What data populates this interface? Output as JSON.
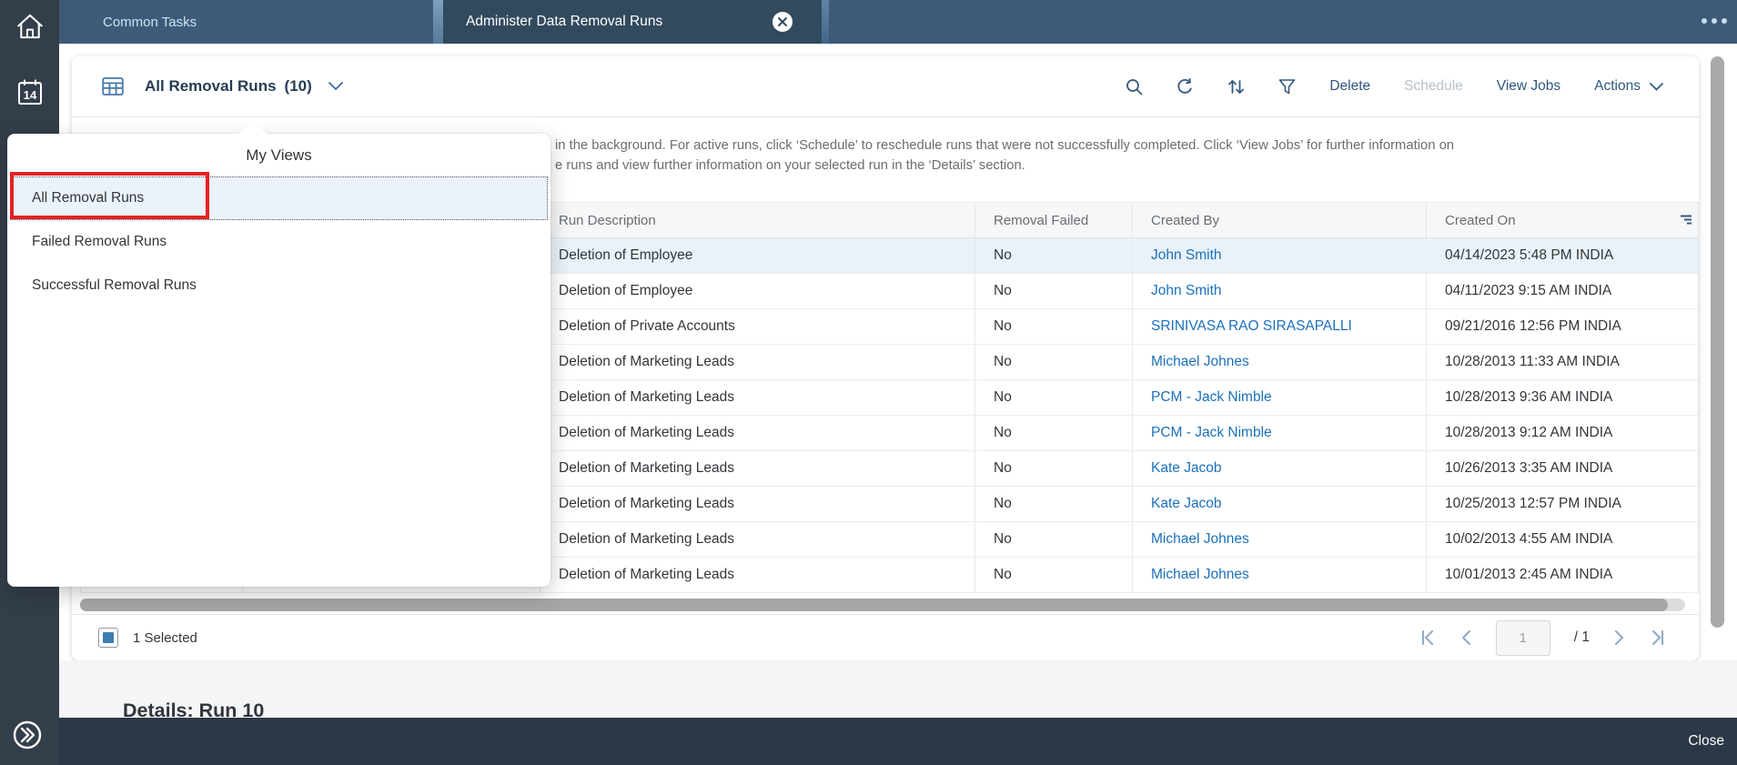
{
  "topbar": {
    "tabs": [
      {
        "label": "Common Tasks",
        "active": false
      },
      {
        "label": "Administer Data Removal Runs",
        "active": true,
        "closable": true
      }
    ]
  },
  "sidebar": {
    "icons": [
      {
        "name": "home"
      },
      {
        "name": "calendar",
        "day": "14"
      },
      {
        "name": "expand"
      }
    ]
  },
  "toolbar": {
    "view_title": "All Removal Runs",
    "count": "(10)",
    "icons": [
      "search-icon",
      "refresh-icon",
      "sort-icon",
      "filter-icon"
    ],
    "buttons": {
      "delete": "Delete",
      "schedule": "Schedule",
      "view_jobs": "View Jobs",
      "actions": "Actions"
    }
  },
  "info": {
    "line1": "in the background. For active runs, click ‘Schedule’ to reschedule runs that were not successfully completed. Click ‘View Jobs’ for further information on",
    "line2": "e runs and view further information on your selected run in the ‘Details’ section."
  },
  "popup": {
    "title": "My Views",
    "items": [
      "All Removal Runs",
      "Failed Removal Runs",
      "Successful Removal Runs"
    ],
    "selected_index": 0
  },
  "table": {
    "columns": [
      "Run Description",
      "Removal Failed",
      "Created By",
      "Created On"
    ],
    "rows": [
      {
        "desc": "Deletion of Employee",
        "failed": "No",
        "created_by": "John Smith",
        "created_on": "04/14/2023 5:48 PM INDIA",
        "selected": true
      },
      {
        "desc": "Deletion of Employee",
        "failed": "No",
        "created_by": "John Smith",
        "created_on": "04/11/2023 9:15 AM INDIA",
        "selected": false
      },
      {
        "desc": "Deletion of Private Accounts",
        "failed": "No",
        "created_by": "SRINIVASA RAO SIRASAPALLI",
        "created_on": "09/21/2016 12:56 PM INDIA",
        "selected": false
      },
      {
        "desc": "Deletion of Marketing Leads",
        "failed": "No",
        "created_by": "Michael Johnes",
        "created_on": "10/28/2013 11:33 AM INDIA",
        "selected": false
      },
      {
        "desc": "Deletion of Marketing Leads",
        "failed": "No",
        "created_by": "PCM - Jack Nimble",
        "created_on": "10/28/2013 9:36 AM INDIA",
        "selected": false
      },
      {
        "desc": "Deletion of Marketing Leads",
        "failed": "No",
        "created_by": "PCM - Jack Nimble",
        "created_on": "10/28/2013 9:12 AM INDIA",
        "selected": false
      },
      {
        "desc": "Deletion of Marketing Leads",
        "failed": "No",
        "created_by": "Kate Jacob",
        "created_on": "10/26/2013 3:35 AM INDIA",
        "selected": false
      },
      {
        "desc": "Deletion of Marketing Leads",
        "failed": "No",
        "created_by": "Kate Jacob",
        "created_on": "10/25/2013 12:57 PM INDIA",
        "selected": false
      },
      {
        "desc": "Deletion of Marketing Leads",
        "failed": "No",
        "created_by": "Michael Johnes",
        "created_on": "10/02/2013 4:55 AM INDIA",
        "selected": false
      },
      {
        "desc": "Deletion of Marketing Leads",
        "failed": "No",
        "created_by": "Michael Johnes",
        "created_on": "10/01/2013 2:45 AM INDIA",
        "selected": false
      }
    ]
  },
  "footer": {
    "selected_text": "1 Selected",
    "pagination": {
      "current": "1",
      "of": "/ 1"
    }
  },
  "details": {
    "heading": "Details: Run 10"
  },
  "bottombar": {
    "close_label": "Close"
  },
  "colors": {
    "topbar": "#3e5a78",
    "active_tab": "#324a5e",
    "sidebar": "#333e4b",
    "bottombar": "#2c3845",
    "link": "#1b70ba",
    "selected_row": "#e9f2f9",
    "highlight_red": "#e52222",
    "accent_blue": "#4878ab"
  }
}
